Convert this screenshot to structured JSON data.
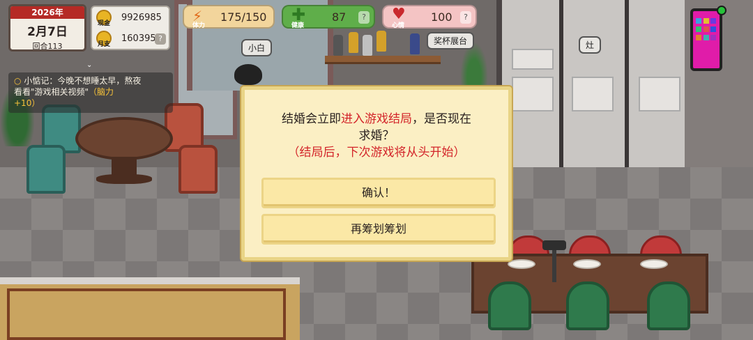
{
  "hud": {
    "year": "2026年",
    "date": "2月7日",
    "round": "回合113",
    "cash_label": "现金",
    "cash_value": "9926985",
    "monthly_label": "月支",
    "monthly_value": "160395",
    "help_glyph": "?"
  },
  "stats": {
    "stamina": {
      "label": "体力",
      "value": "175/150",
      "icon": "lightning-icon"
    },
    "health": {
      "label": "健康",
      "value": "87",
      "icon": "cross-icon"
    },
    "mood": {
      "label": "心情",
      "value": "100",
      "icon": "heart-icon"
    }
  },
  "memo": {
    "line1": "小惦记：今晚不想睡太早，熬夜",
    "line2": "看看\"游戏相关视频\"",
    "bonus": "（脑力",
    "bonus2": "+10）"
  },
  "scene_labels": {
    "cat_name": "小白",
    "trophy_shelf": "奖杯展台",
    "stove": "灶"
  },
  "dialog": {
    "line1_pre": "结婚会立即",
    "line1_red": "进入游戏结局",
    "line1_post": "，是否现在",
    "line2": "求婚？",
    "line3": "（结局后，下次游戏将从头开始）",
    "confirm_label": "确认！",
    "reconsider_label": "再筹划筹划"
  },
  "colors": {
    "accent_red": "#d3252a",
    "dialog_bg": "#fbefc4",
    "button_bg": "#fbe8a6"
  }
}
